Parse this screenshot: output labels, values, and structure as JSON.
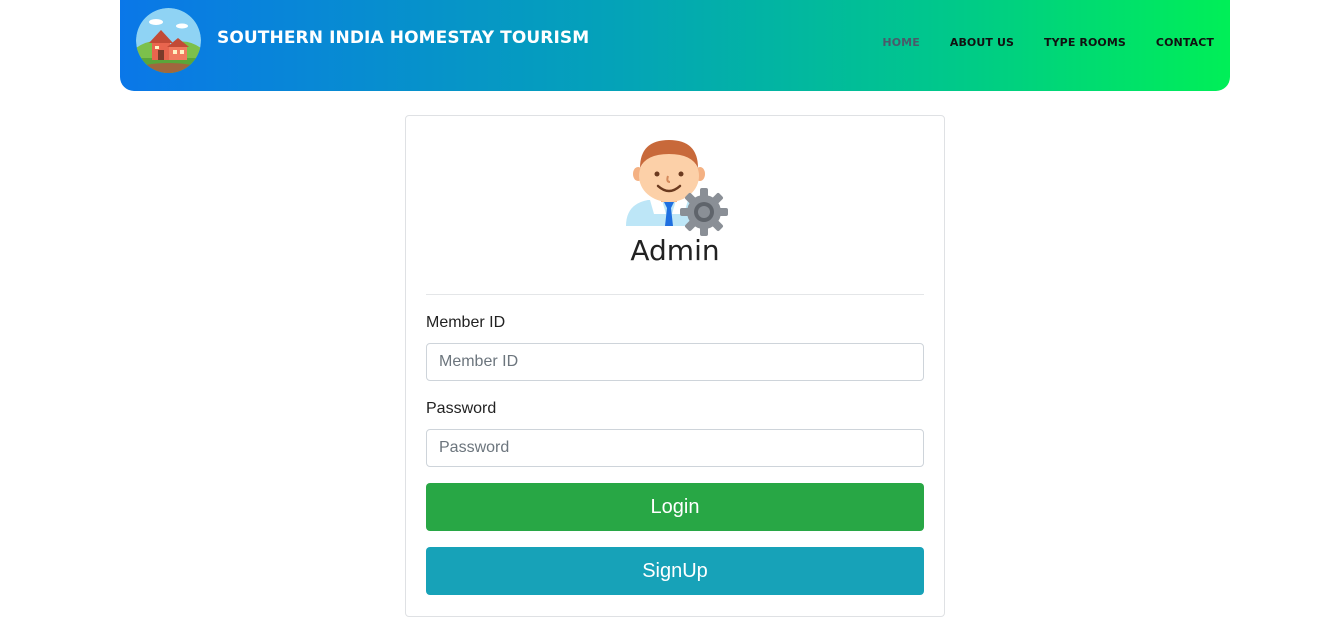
{
  "header": {
    "brand": "SOUTHERN INDIA HOMESTAY TOURISM",
    "logo_icon": "homestay-house-icon",
    "nav": [
      {
        "label": "HOME",
        "active": true
      },
      {
        "label": "ABOUT US",
        "active": false
      },
      {
        "label": "TYPE ROOMS",
        "active": false
      },
      {
        "label": "CONTACT",
        "active": false
      }
    ]
  },
  "login": {
    "avatar_icon": "admin-user-gear-icon",
    "title": "Admin",
    "member_id_label": "Member ID",
    "member_id_placeholder": "Member ID",
    "member_id_value": "",
    "password_label": "Password",
    "password_placeholder": "Password",
    "password_value": "",
    "login_button": "Login",
    "signup_button": "SignUp"
  },
  "colors": {
    "header_gradient_start": "#0a77e8",
    "header_gradient_end": "#00ef57",
    "login_button": "#28a745",
    "signup_button": "#17a2b8"
  }
}
